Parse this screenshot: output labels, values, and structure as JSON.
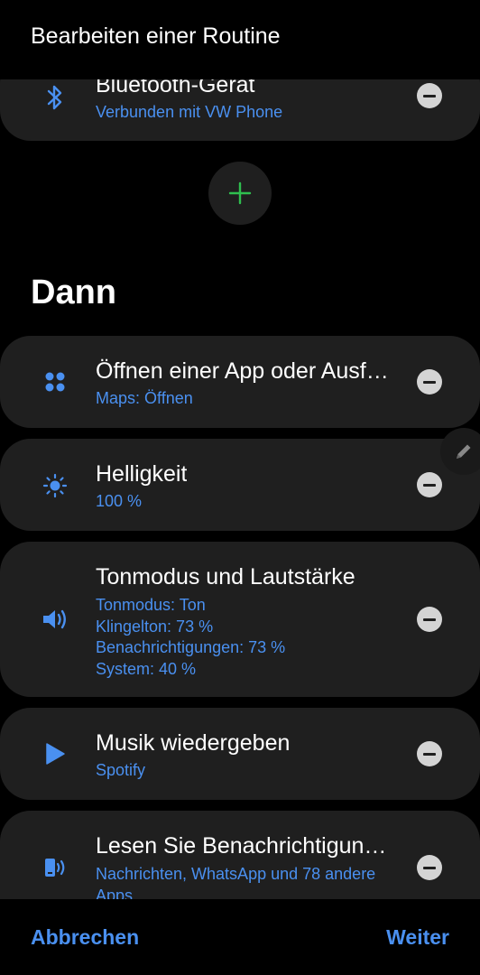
{
  "header": {
    "title": "Bearbeiten einer Routine"
  },
  "if_cards": [
    {
      "icon": "bluetooth-icon",
      "title": "Bluetooth-Gerät",
      "subs": [
        "Verbunden mit VW Phone"
      ]
    }
  ],
  "section_title": "Dann",
  "then_cards": [
    {
      "icon": "apps-grid-icon",
      "title": "Öffnen einer App oder Ausf…",
      "subs": [
        "Maps: Öffnen"
      ]
    },
    {
      "icon": "brightness-icon",
      "title": "Helligkeit",
      "subs": [
        "100 %"
      ]
    },
    {
      "icon": "volume-icon",
      "title": "Tonmodus und Lautstärke",
      "subs": [
        "Tonmodus: Ton",
        "Klingelton: 73 %",
        "Benachrichtigungen: 73 %",
        "System: 40 %"
      ]
    },
    {
      "icon": "play-icon",
      "title": "Musik wiedergeben",
      "subs": [
        "Spotify"
      ]
    },
    {
      "icon": "read-notifications-icon",
      "title": "Lesen Sie Benachrichtigun…",
      "subs": [
        "Nachrichten, WhatsApp und 78 andere",
        "Apps"
      ]
    }
  ],
  "bottom": {
    "cancel_label": "Abbrechen",
    "next_label": "Weiter"
  },
  "colors": {
    "accent": "#4a90f0",
    "add_plus": "#2fbf4f",
    "card_bg": "#1f1f1f",
    "background": "#000000"
  }
}
